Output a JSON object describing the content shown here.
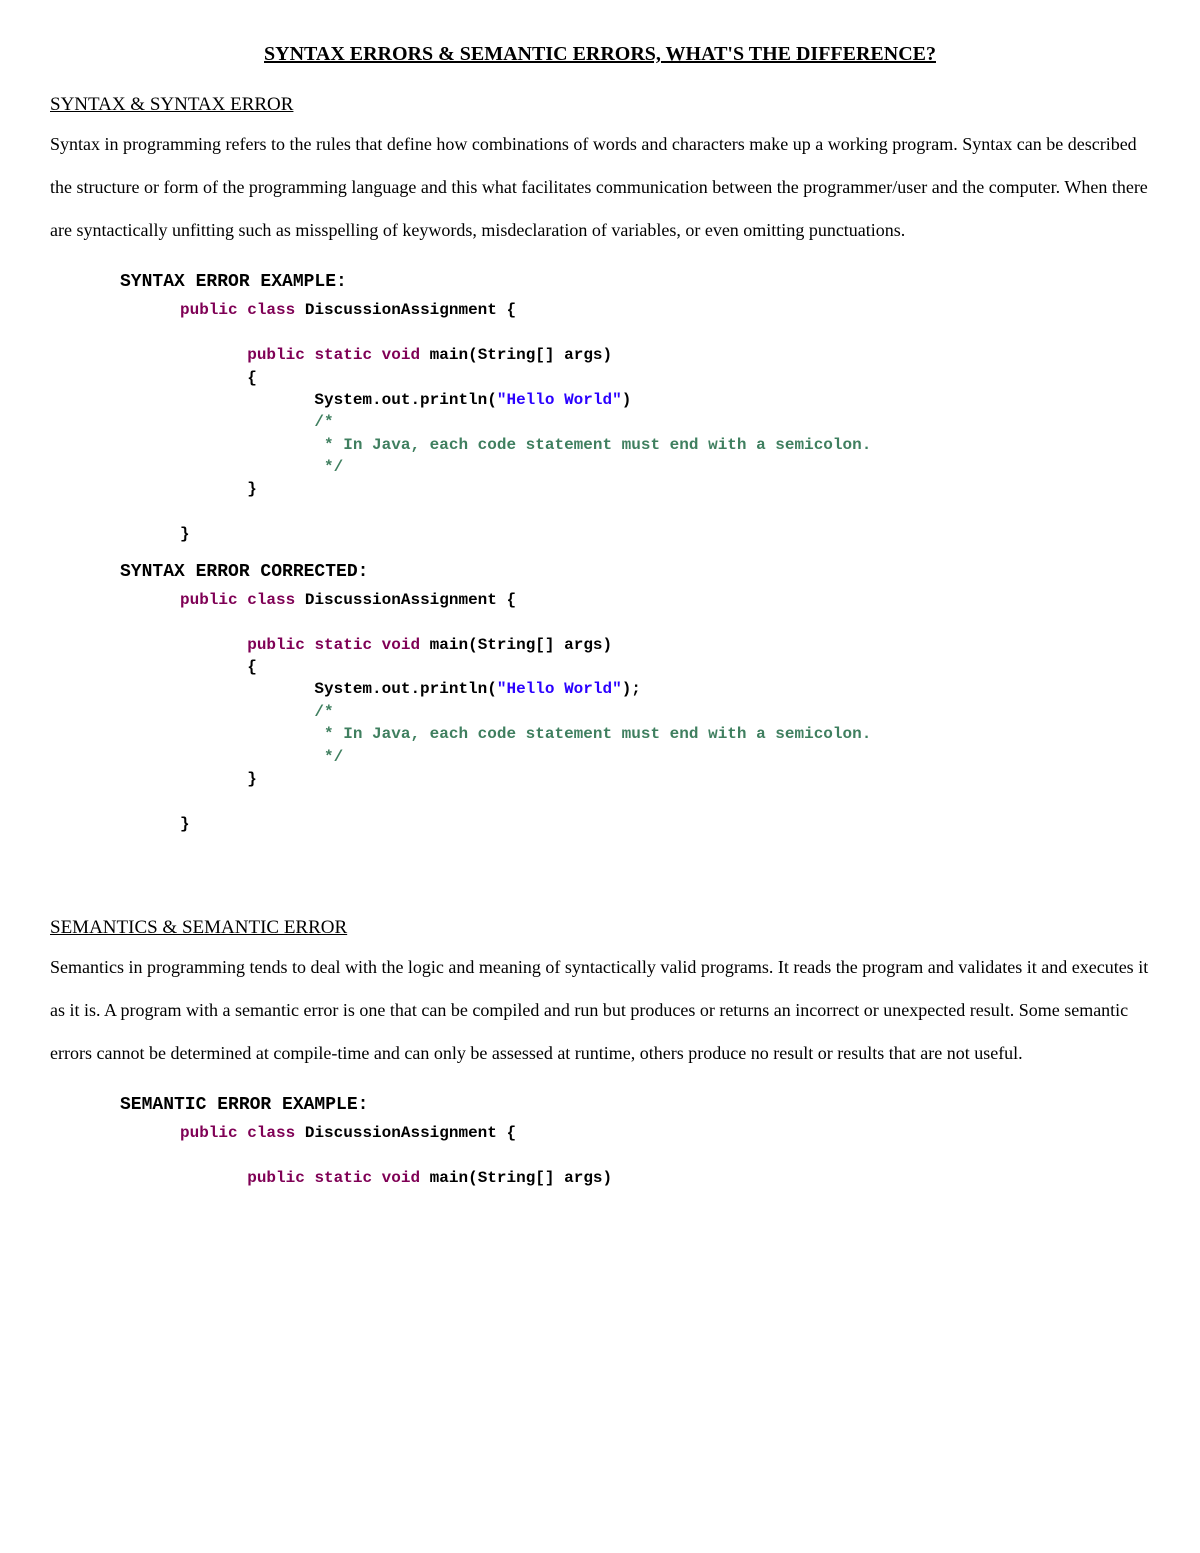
{
  "title": "SYNTAX ERRORS & SEMANTIC ERRORS, WHAT'S THE DIFFERENCE?",
  "syntax": {
    "heading": "SYNTAX & SYNTAX ERROR",
    "body": "Syntax in programming refers to the rules that define how combinations of words and characters make up a working program. Syntax can be described the structure or form of the programming language and this what facilitates communication between the programmer/user and the computer. When there are syntactically unfitting such as misspelling of keywords, misdeclaration of variables, or even omitting punctuations.",
    "example_heading": "SYNTAX ERROR EXAMPLE:",
    "corrected_heading": "SYNTAX ERROR CORRECTED:"
  },
  "code_tokens": {
    "kw_public": "public",
    "kw_class": "class",
    "kw_static": "static",
    "kw_void": "void",
    "id_class": "DiscussionAssignment",
    "id_main": "main",
    "id_string": "String",
    "id_args": "args",
    "sys_out": "System.out.println",
    "str_hello": "\"Hello World\"",
    "cmt_open": "/*",
    "cmt_line": " * In Java, each code statement must end with a semicolon.",
    "cmt_close": " */",
    "brace_open": "{",
    "brace_close": "}",
    "paren_open": "(",
    "paren_close": ")",
    "paren_close_semi": ");",
    "brackets": "[]"
  },
  "semantics": {
    "heading": "SEMANTICS & SEMANTIC ERROR",
    "body": "Semantics in programming tends to deal with the logic and meaning of syntactically valid programs. It reads the program and validates it and executes it as it is. A program with a semantic error is one that can be compiled and run but produces or returns an incorrect or unexpected result. Some semantic errors cannot be determined at compile-time and can only be assessed at runtime, others produce no result or results that are not useful.",
    "example_heading": "SEMANTIC ERROR EXAMPLE:"
  }
}
